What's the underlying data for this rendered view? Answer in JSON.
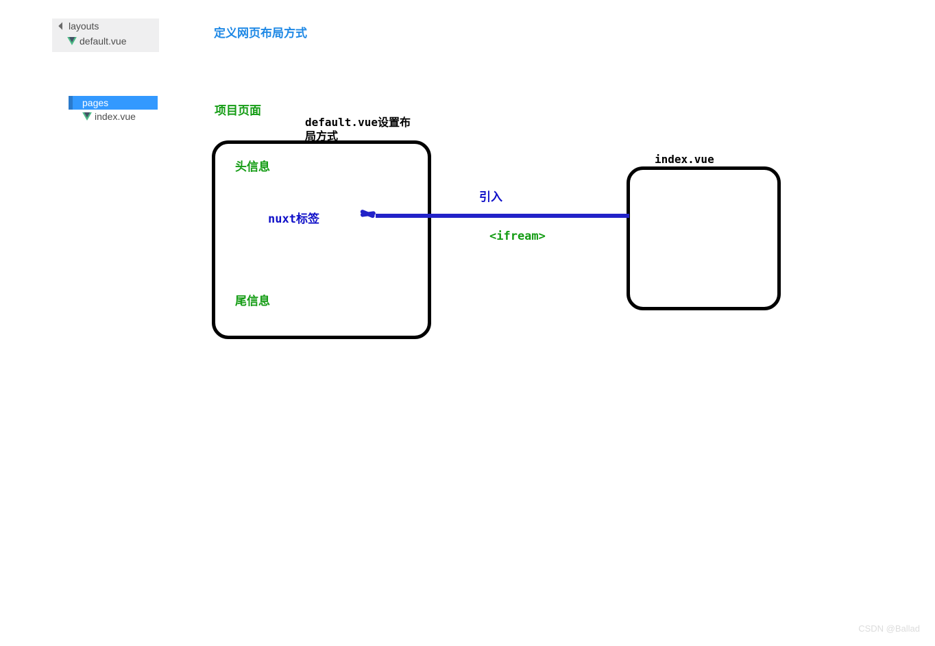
{
  "tree_layouts": {
    "folder": "layouts",
    "file": "default.vue"
  },
  "tree_pages": {
    "folder": "pages",
    "file": "index.vue"
  },
  "title": "定义网页布局方式",
  "labels": {
    "project_page": "项目页面",
    "default_vue_caption": "default.vue设置布局方式",
    "header_info": "头信息",
    "nuxt_tag": "nuxt标签",
    "footer_info": "尾信息",
    "import": "引入",
    "ifream": "<ifream>",
    "index_vue": "index.vue"
  },
  "watermark": "CSDN @Ballad"
}
